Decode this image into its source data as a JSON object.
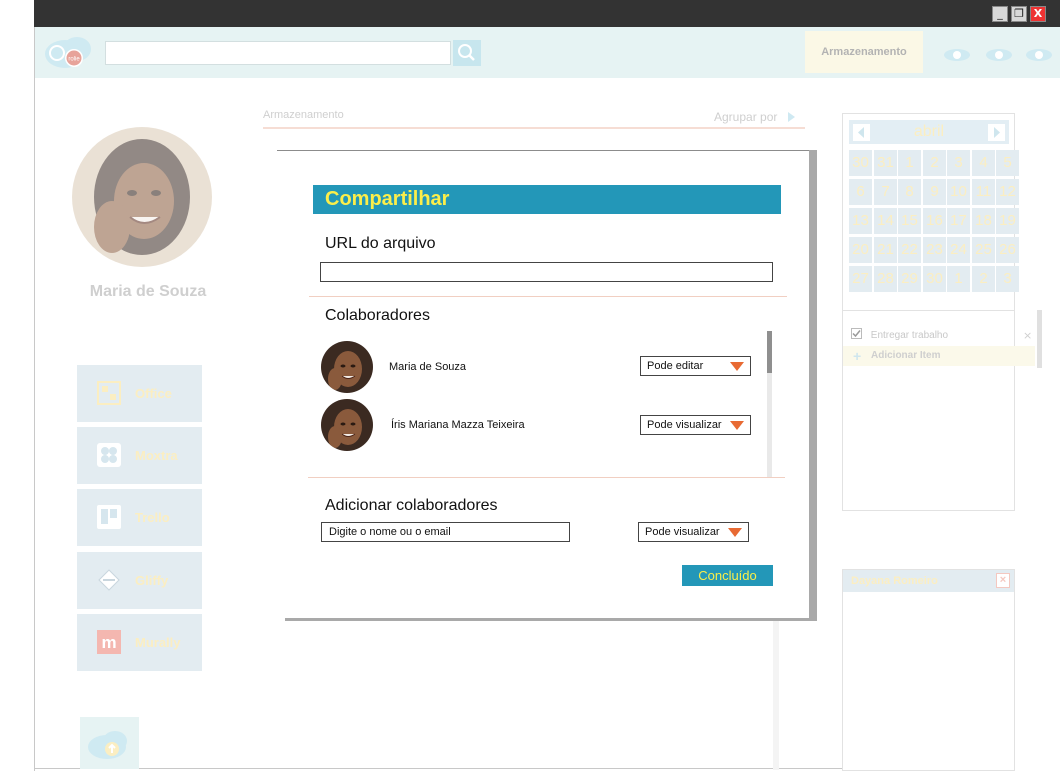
{
  "window": {
    "minimize_glyph": "_",
    "maximize_glyph": "❐",
    "close_glyph": "X"
  },
  "topbar": {
    "logo_text": "rolie",
    "search": {
      "value": "",
      "placeholder": ""
    },
    "storage_tab_label": "Armazenamento",
    "icons": [
      "search-icon",
      "notification-icon",
      "info-icon",
      "settings-icon"
    ]
  },
  "sidebar": {
    "user_name": "Maria de Souza",
    "apps": [
      {
        "label": "Office",
        "icon": "office-icon"
      },
      {
        "label": "Moxtra",
        "icon": "moxtra-icon"
      },
      {
        "label": "Trello",
        "icon": "trello-icon"
      },
      {
        "label": "Gliffy",
        "icon": "gliffy-icon"
      },
      {
        "label": "Murally",
        "icon": "murally-icon"
      }
    ],
    "upload_icon": "cloud-upload-icon"
  },
  "main": {
    "title": "Armazenamento",
    "group_by_label": "Agrupar por"
  },
  "calendar": {
    "month": "abril",
    "weeks": [
      [
        "30",
        "31",
        "1",
        "2",
        "3",
        "4",
        "5"
      ],
      [
        "6",
        "7",
        "8",
        "9",
        "10",
        "11",
        "12"
      ],
      [
        "13",
        "14",
        "15",
        "16",
        "17",
        "18",
        "19"
      ],
      [
        "20",
        "21",
        "22",
        "23",
        "24",
        "25",
        "26"
      ],
      [
        "27",
        "28",
        "29",
        "30",
        "1",
        "2",
        "3"
      ]
    ]
  },
  "tasks": {
    "items": [
      {
        "label": "Entregar trabalho",
        "done": true
      }
    ],
    "add_label": "Adicionar Item",
    "remove_glyph": "×"
  },
  "chat": {
    "contact_name": "Dayana Romeiro",
    "close_glyph": "×"
  },
  "share_dialog": {
    "title": "Compartilhar",
    "url_label": "URL do arquivo",
    "url_value": "",
    "collaborators_label": "Colaboradores",
    "collaborators": [
      {
        "name": "Maria de Souza",
        "permission": "Pode editar"
      },
      {
        "name": "Íris Mariana Mazza Teixeira",
        "permission": "Pode visualizar"
      }
    ],
    "add_label": "Adicionar colaboradores",
    "add_placeholder": "Digite o nome ou o email",
    "add_permission": "Pode visualizar",
    "done_label": "Concluído"
  },
  "colors": {
    "accent_blue": "#2397b8",
    "title_yellow": "#fbee4a",
    "dropdown_orange": "#e86a33",
    "titlebar": "#333333"
  }
}
